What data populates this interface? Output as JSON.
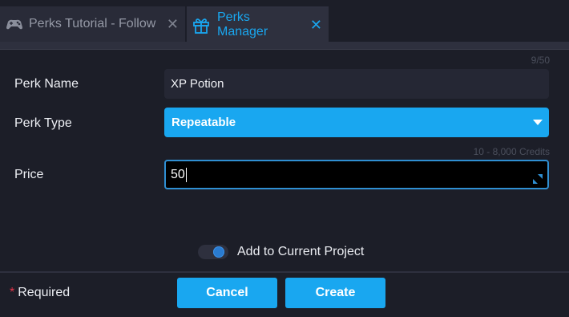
{
  "tabs": [
    {
      "label": "Perks Tutorial - Follow",
      "icon": "controller-icon",
      "close": "✕"
    },
    {
      "label": "Perks Manager",
      "icon": "gift-icon",
      "close": "✕"
    }
  ],
  "form": {
    "counter": "9/50",
    "perk_name": {
      "label": "Perk Name",
      "value": "XP Potion"
    },
    "perk_type": {
      "label": "Perk Type",
      "value": "Repeatable"
    },
    "credits_hint": "10 - 8,000 Credits",
    "price": {
      "label": "Price",
      "value": "50"
    }
  },
  "toggle": {
    "label": "Add to Current Project"
  },
  "footer": {
    "required_star": "*",
    "required_label": "Required",
    "cancel_label": "Cancel",
    "create_label": "Create"
  },
  "colors": {
    "accent": "#19a7f0",
    "background": "#1c1e28",
    "required_star": "#e0344a"
  }
}
